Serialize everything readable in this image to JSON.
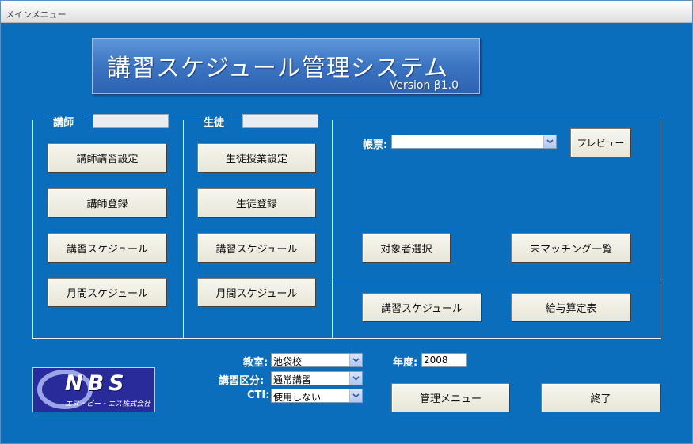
{
  "window": {
    "title": "メインメニュー"
  },
  "banner": {
    "title": "講習スケジュール管理システム",
    "version": "Version β1.0"
  },
  "teacher": {
    "legend": "講師",
    "buttons": [
      "講師講習設定",
      "講師登録",
      "講習スケジュール",
      "月間スケジュール"
    ]
  },
  "student": {
    "legend": "生徒",
    "buttons": [
      "生徒授業設定",
      "生徒登録",
      "講習スケジュール",
      "月間スケジュール"
    ]
  },
  "report": {
    "label": "帳票:",
    "value": "",
    "preview_label": "プレビュー",
    "target_select_label": "対象者選択",
    "unmatched_label": "未マッチング一覧",
    "schedule_label": "講習スケジュール",
    "salary_label": "給与算定表"
  },
  "filters": {
    "classroom_label": "教室:",
    "classroom_value": "池袋校",
    "course_type_label": "講習区分:",
    "course_type_value": "通常講習",
    "cti_label": "CTI:",
    "cti_value": "使用しない",
    "year_label": "年度:",
    "year_value": "2008"
  },
  "footer": {
    "admin_menu_label": "管理メニュー",
    "exit_label": "終了"
  },
  "logo": {
    "text": "NBS",
    "sub": "エヌ・ビー・エス株式会社"
  },
  "colors": {
    "background": "#0b6ebd",
    "banner": "#3b74c2",
    "button": "#ece9d8"
  }
}
